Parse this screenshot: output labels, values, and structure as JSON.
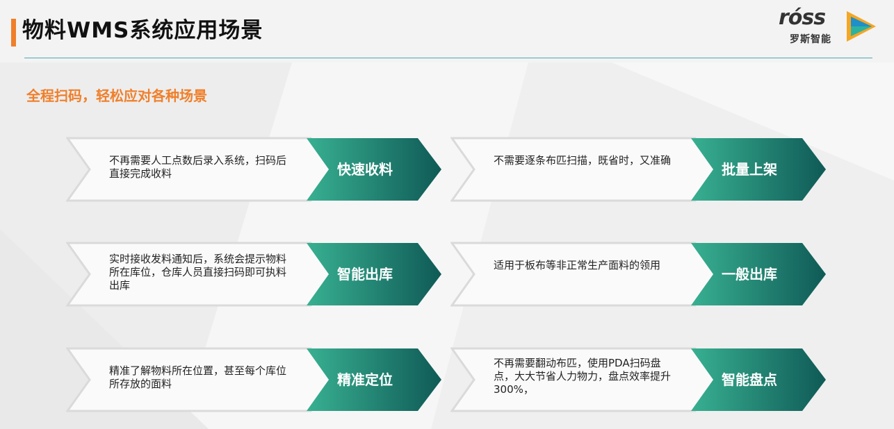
{
  "header": {
    "title": "物料WMS系统应用场景",
    "logo_text": "róss",
    "logo_cn": "罗斯智能"
  },
  "subtitle": "全程扫码，轻松应对各种场景",
  "colors": {
    "accent": "#f07f2a",
    "rule": "#4ba9b8",
    "arrow_start": "#38b091",
    "arrow_end": "#0f5a56"
  },
  "cards": [
    {
      "desc": "不再需要人工点数后录入系统，扫码后直接完成收料",
      "label": "快速收料"
    },
    {
      "desc": "不需要逐条布匹扫描，既省时，又准确",
      "label": "批量上架"
    },
    {
      "desc": "实时接收发料通知后，系统会提示物料所在库位，仓库人员直接扫码即可执料出库",
      "label": "智能出库"
    },
    {
      "desc": "适用于板布等非正常生产面料的领用",
      "label": "一般出库"
    },
    {
      "desc": "精准了解物料所在位置，甚至每个库位所存放的面料",
      "label": "精准定位"
    },
    {
      "desc": "不再需要翻动布匹，使用PDA扫码盘点，大大节省人力物力，盘点效率提升300%，",
      "label": "智能盘点"
    }
  ]
}
